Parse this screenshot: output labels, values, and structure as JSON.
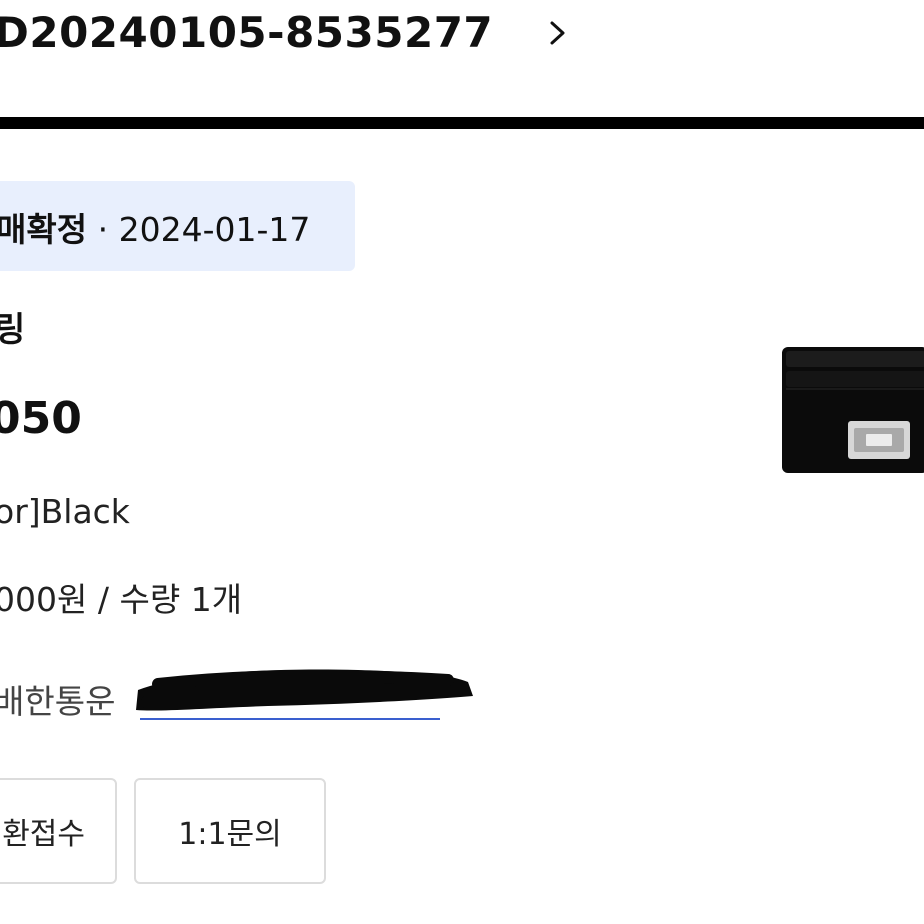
{
  "order": {
    "number": "D20240105-8535277"
  },
  "status": {
    "label": "매확정",
    "separator": "·",
    "date": "2024-01-17"
  },
  "product": {
    "brand": "링",
    "model": "050",
    "option": "or]Black",
    "price": "000원",
    "quantity_sep": "/",
    "quantity": "수량 1개",
    "image_icon": "wallet-image"
  },
  "delivery": {
    "label": "배한통운",
    "tracking_icon": "redaction-mark"
  },
  "actions": {
    "exchange": "환접수",
    "inquiry": "1:1문의"
  },
  "colors": {
    "chip_bg": "#e8effd",
    "divider": "#000000",
    "link": "#3a5fcf"
  }
}
